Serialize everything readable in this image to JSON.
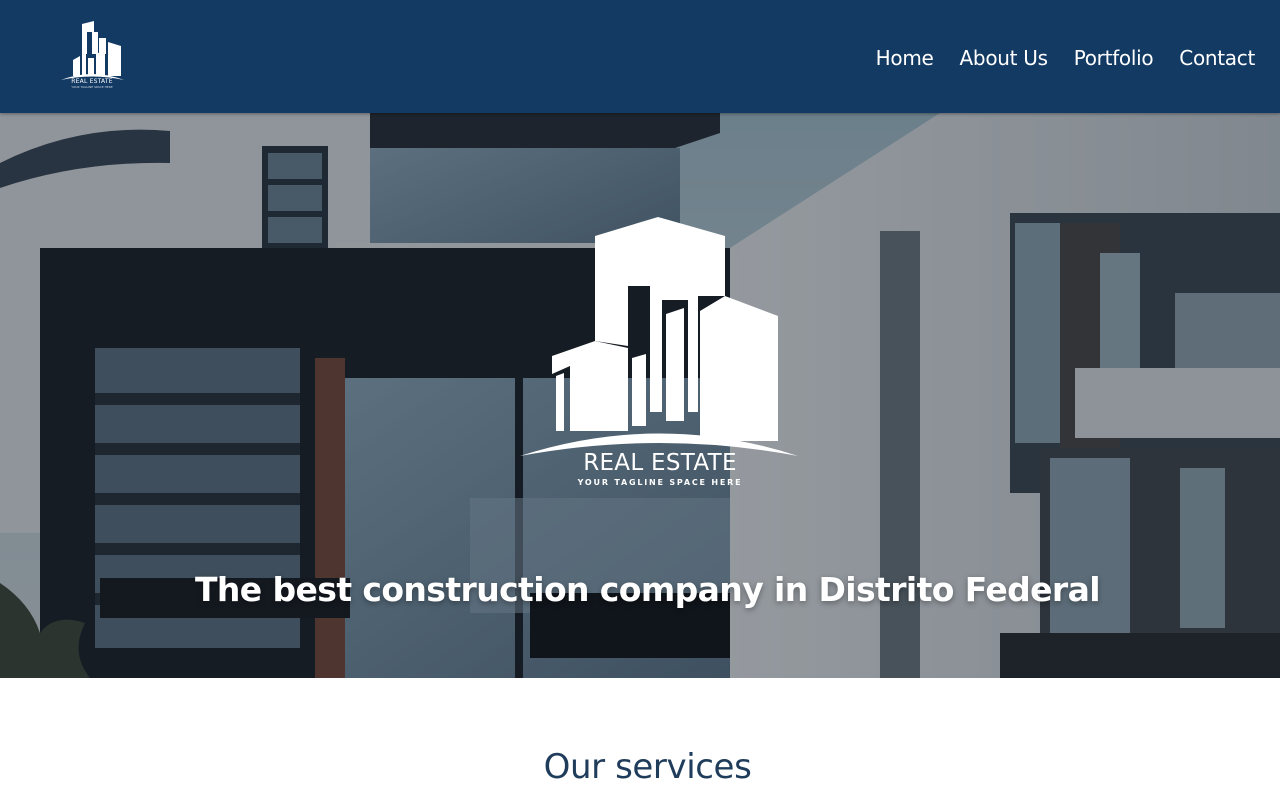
{
  "header": {
    "logo": {
      "icon": "buildings-logo-icon",
      "name": "REAL ESTATE",
      "tagline": "YOUR TAGLINE SPACE HERE"
    },
    "nav": [
      {
        "label": "Home"
      },
      {
        "label": "About Us"
      },
      {
        "label": "Portfolio"
      },
      {
        "label": "Contact"
      }
    ]
  },
  "hero": {
    "background": "modern-residential-building-photo",
    "logo": {
      "icon": "buildings-logo-icon",
      "name": "REAL ESTATE",
      "tagline": "YOUR TAGLINE SPACE HERE"
    },
    "headline": "The best construction company in Distrito Federal"
  },
  "services": {
    "title": "Our services"
  },
  "colors": {
    "header_bg": "#133a63",
    "nav_text": "#ffffff",
    "section_title": "#1f3c5b"
  }
}
